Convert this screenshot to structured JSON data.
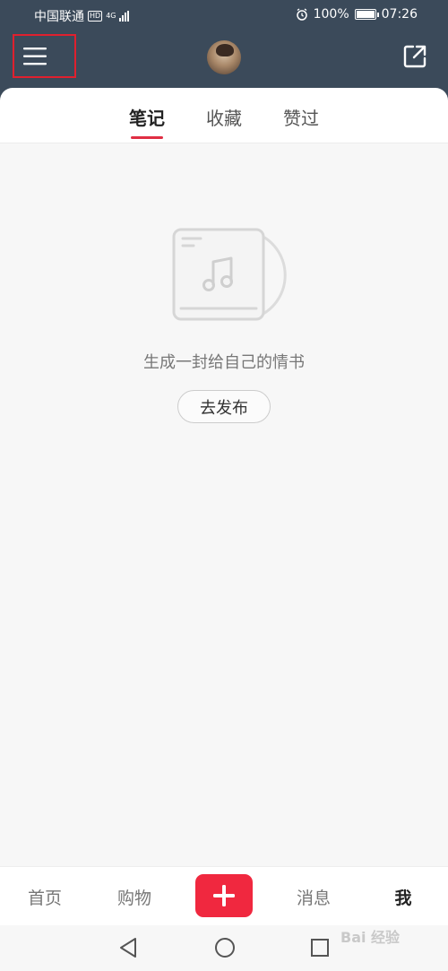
{
  "status_bar": {
    "carrier": "中国联通",
    "hd_badge": "HD",
    "network": "4G",
    "battery_text": "100%",
    "battery_level": 1.0,
    "time": "07:26"
  },
  "header": {
    "menu_icon": "hamburger-icon",
    "share_icon": "share-external-icon"
  },
  "tabs": [
    {
      "label": "笔记",
      "active": true
    },
    {
      "label": "收藏",
      "active": false
    },
    {
      "label": "赞过",
      "active": false
    }
  ],
  "empty_state": {
    "message": "生成一封给自己的情书",
    "button": "去发布"
  },
  "bottom_nav": {
    "items": [
      {
        "label": "首页"
      },
      {
        "label": "购物"
      },
      {
        "label": "消息"
      },
      {
        "label": "我"
      }
    ],
    "plus_label": "+"
  },
  "watermark": "Bai 经验",
  "colors": {
    "header_bg": "#3b4a5a",
    "accent": "#f0283f",
    "highlight_box": "#e0202e"
  }
}
